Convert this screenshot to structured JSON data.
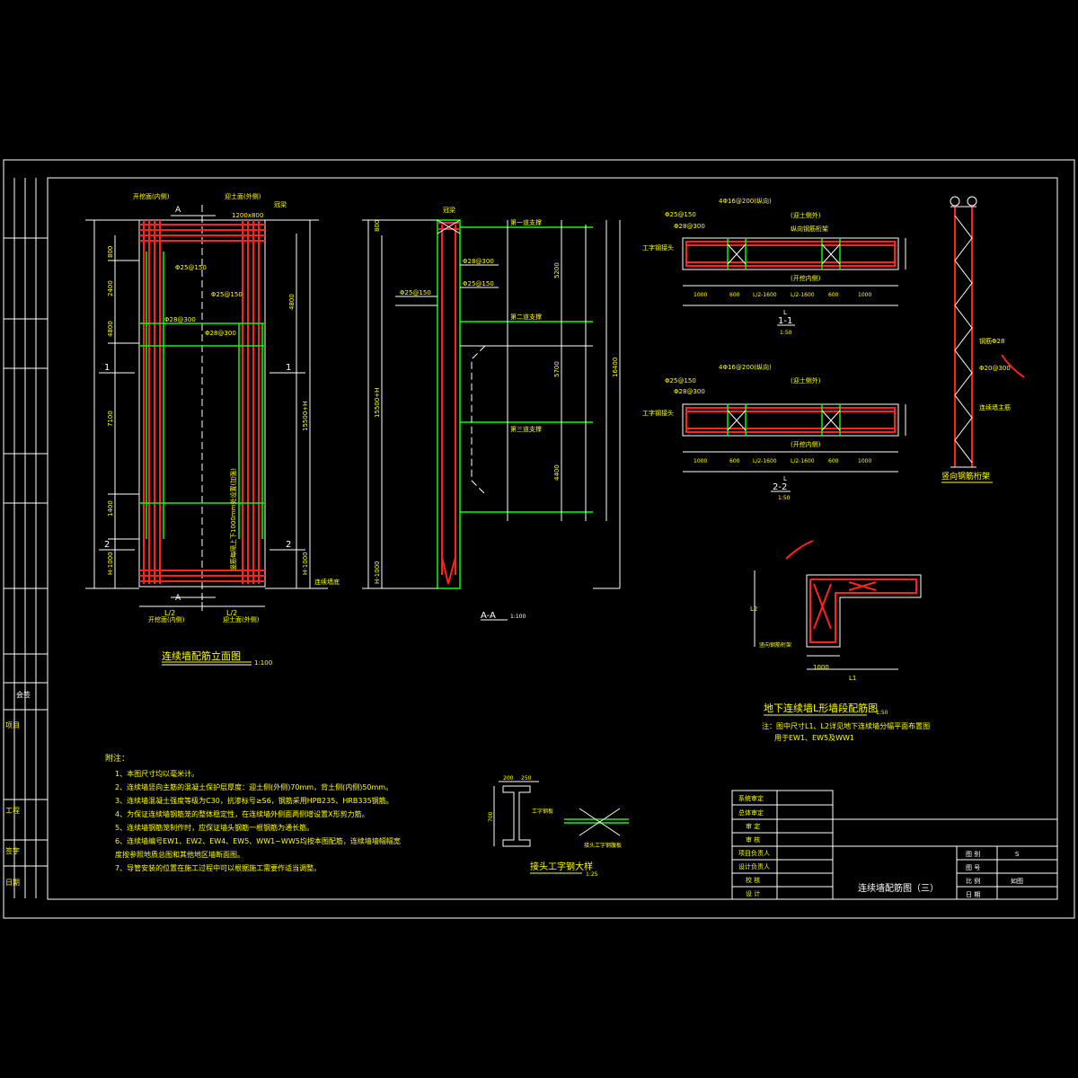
{
  "views": {
    "elevation": {
      "title": "连续墙配筋立面图",
      "scale": "1:100",
      "label_left_face": "开挖面(内侧)",
      "label_right_face": "迎土面(外侧)",
      "label_guide": "冠梁",
      "label_top_size": "1200x800",
      "section_mark": "A",
      "bottom_left": "开挖面(内侧)",
      "bottom_right": "迎土面(外侧)",
      "dim_l2_left": "L/2",
      "dim_l2_right": "L/2",
      "mark_1": "1",
      "mark_2": "2",
      "dim_left": [
        "800",
        "2400",
        "4800",
        "7100",
        "1400",
        "H-1000"
      ],
      "dim_right": [
        "H-1000",
        "4800",
        "15500+H"
      ],
      "rebar_a": "Φ25@150",
      "rebar_b": "Φ28@300",
      "rebar_c": "Φ25@150",
      "rebar_d": "Φ28@300",
      "note_vertical": "竖筋每隔上下1000mm处设置(加强)",
      "label_bottom": "连续墙底"
    },
    "section_aa": {
      "title": "A-A",
      "scale": "1:100",
      "label_top": "冠梁",
      "label_support1": "第一道支撑",
      "label_support2": "第二道支撑",
      "label_support3": "第三道支撑",
      "rebar_a": "Φ25@150",
      "rebar_b": "Φ28@300",
      "dim_left": [
        "800",
        "15500+H",
        "H-1000"
      ],
      "dim_right": [
        "5200",
        "5700",
        "4400",
        "16400"
      ]
    },
    "section_11": {
      "title": "1-1",
      "scale": "1:50",
      "top_label": "4Φ16@200(纵向)",
      "side_label": "(迎土侧外)",
      "inner_label": "(开挖内侧)",
      "rebar_a": "Φ25@150",
      "rebar_b": "Φ28@300",
      "label_joint": "工字钢接头",
      "dims": [
        "1000",
        "600",
        "L/2-1600",
        "L/2-1600",
        "600",
        "1000"
      ],
      "dim_total": "L",
      "label_cross": "纵向钢筋桁架"
    },
    "section_22": {
      "title": "2-2",
      "scale": "1:50",
      "top_label": "4Φ16@200(纵向)",
      "side_label": "(迎土侧外)",
      "inner_label": "(开挖内侧)",
      "rebar_a": "Φ25@150",
      "rebar_b": "Φ28@300",
      "label_joint": "工字钢接头",
      "dims": [
        "1000",
        "600",
        "L/2-1600",
        "L/2-1600",
        "600",
        "1000"
      ],
      "dim_total": "L"
    },
    "truss": {
      "title": "竖向钢筋桁架",
      "label_a": "钢筋Φ28",
      "label_b": "Φ20@300",
      "label_c": "连续墙主筋"
    },
    "l_wall": {
      "title": "地下连续墙L形墙段配筋图",
      "scale": "1:50",
      "dim_a": "1000",
      "dim_b": "L1",
      "dim_c": "L2",
      "label_a": "竖向钢筋桁架",
      "note_line1": "注：图中尺寸L1、L2详见地下连续墙分幅平面布置图",
      "note_line2": "用于EW1、EW5及WW1"
    },
    "ibeam": {
      "title": "接头工字钢大样",
      "scale": "1:25",
      "dim_top": [
        "200",
        "250"
      ],
      "dim_h": "700",
      "label_a": "工字钢板",
      "label_b": "接头工字钢腹板"
    }
  },
  "notes": {
    "heading": "附注：",
    "items": [
      "1、本图尺寸均以毫米计。",
      "2、连续墙竖向主筋的混凝土保护层厚度：迎土侧(外侧)70mm，背土侧(内侧)50mm。",
      "3、连续墙混凝土强度等级为C30，抗渗标号≥S6，钢筋采用HPB235、HRB335钢筋。",
      "4、为保证连续墙钢筋笼的整体稳定性，在连续墙外侧面两侧增设置X形剪力筋。",
      "5、连续墙钢筋笼制作时，应保证墙头钢筋一根钢筋为通长筋。",
      "6、连续墙编号EW1、EW2、EW4、EW5、WW1~WW5均按本图配筋，连续墙墙幅幅宽",
      "   度按参照地质总图和其他地区墙断面图。",
      "7、导管安装的位置在施工过程中可以根据施工需要作适当调整。"
    ]
  },
  "title_block": {
    "review_rows": [
      "系统审定",
      "总体审定"
    ],
    "role_rows": [
      "审 定",
      "审 核",
      "项目负责人",
      "设计负责人",
      "校 核",
      "设 计"
    ],
    "drawing_title": "连续墙配筋图（三）",
    "info_labels": [
      "图 别",
      "图 号",
      "比 例",
      "日 期"
    ],
    "info_values": [
      "S",
      "",
      "如图",
      ""
    ]
  },
  "left_strip": {
    "cells": [
      "项目",
      "工程",
      "签字",
      "日期",
      "会签"
    ]
  }
}
